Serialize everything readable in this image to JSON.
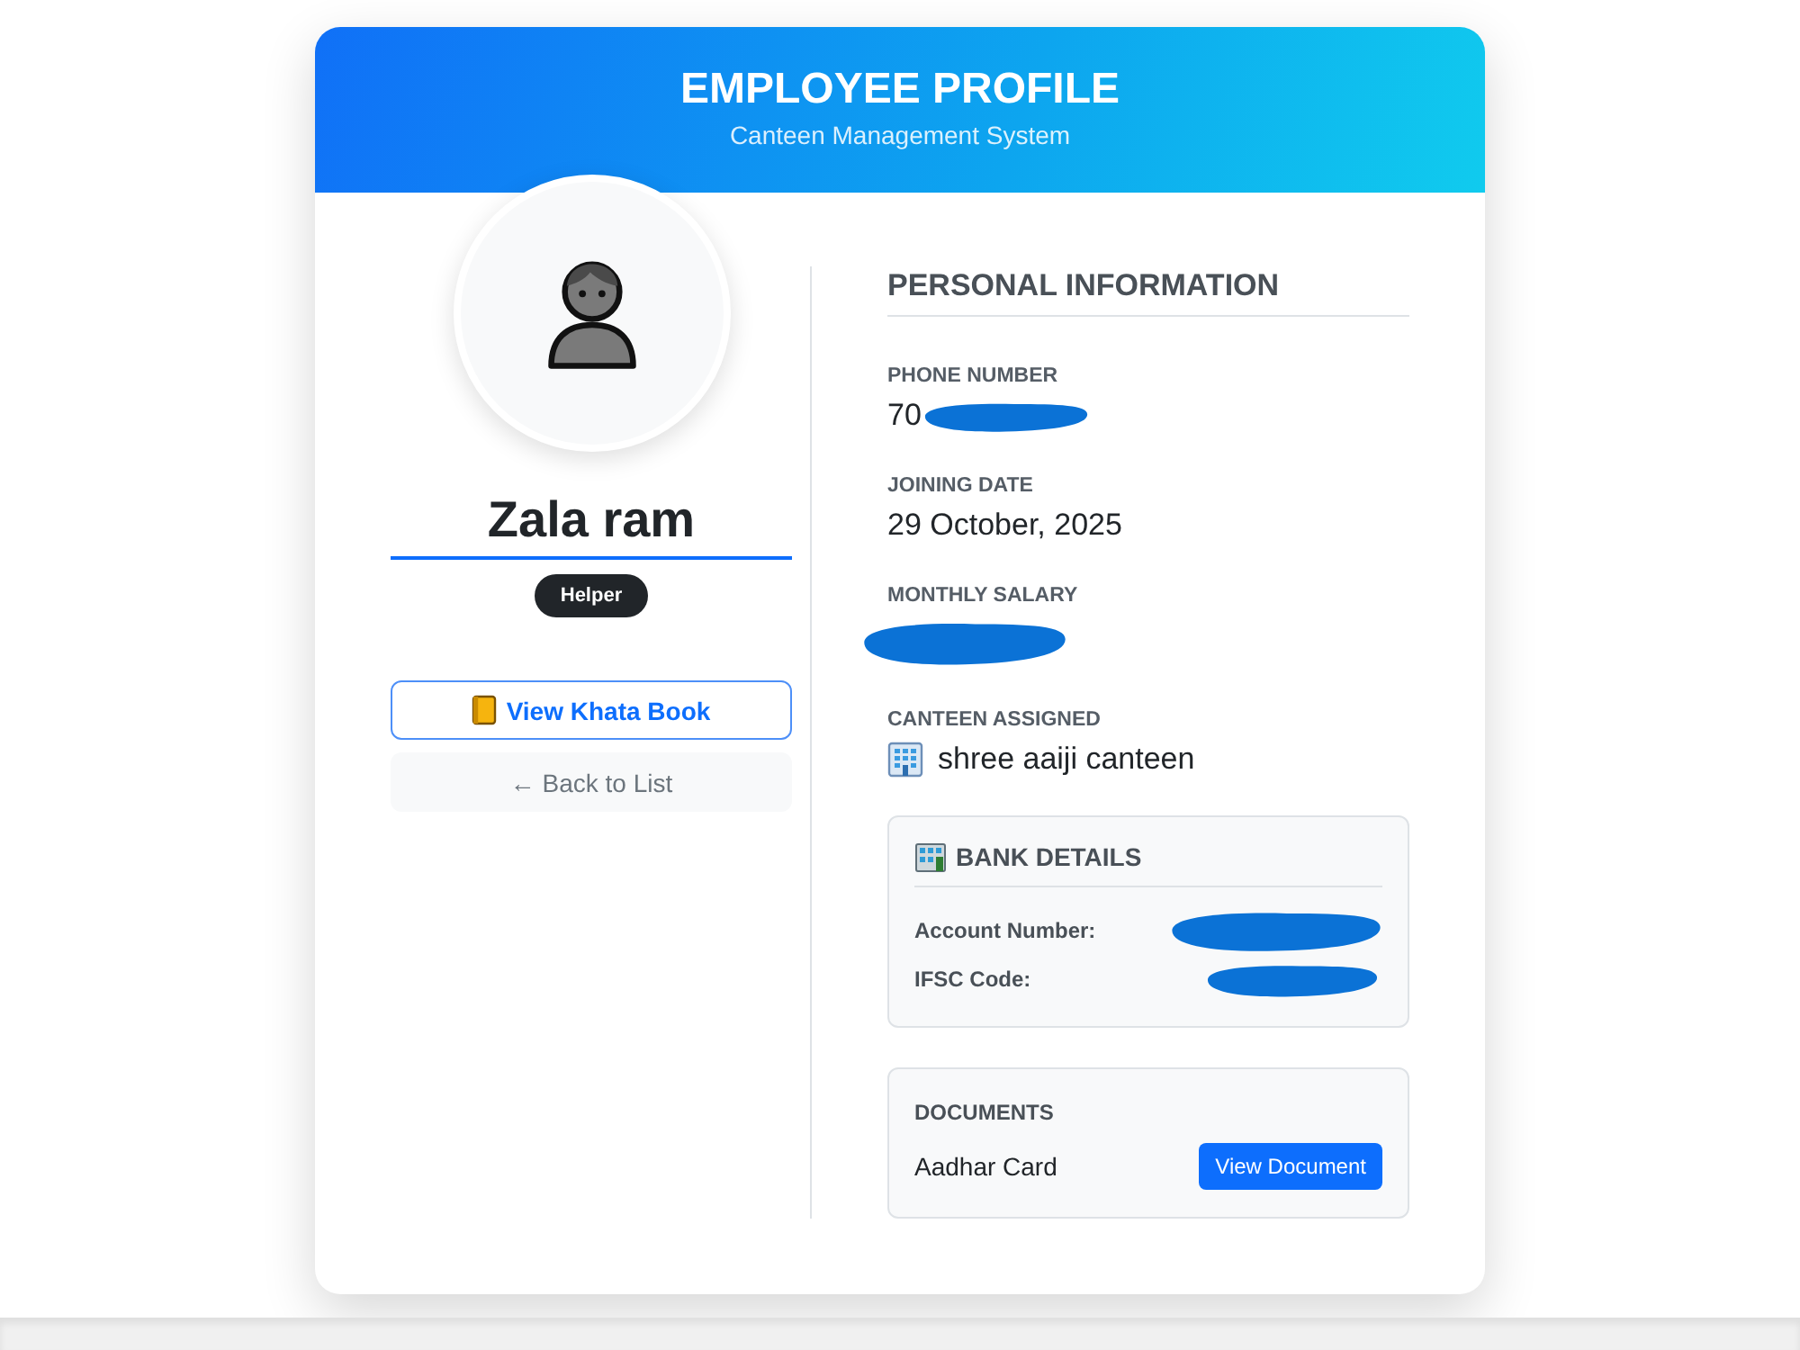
{
  "header": {
    "title": "EMPLOYEE PROFILE",
    "subtitle": "Canteen Management System"
  },
  "profile": {
    "name": "Zala ram",
    "role": "Helper"
  },
  "actions": [
    {
      "label": "View Khata Book",
      "kind": "primary"
    },
    {
      "label": "← Back to List",
      "kind": "secondary"
    }
  ],
  "personal_information": {
    "title": "PERSONAL INFORMATION",
    "fields": [
      {
        "label": "PHONE NUMBER",
        "value": "70",
        "kind": "text",
        "redacted": true
      },
      {
        "label": "JOINING DATE",
        "value": "29 October, 2025",
        "kind": "text",
        "redacted": false
      },
      {
        "label": "MONTHLY SALARY",
        "kind": "text",
        "redacted": true
      },
      {
        "label": "CANTEEN ASSIGNED",
        "value": "shree aaiji canteen",
        "kind": "place",
        "redacted": false
      }
    ]
  },
  "bank_details": {
    "title": "BANK DETAILS",
    "rows": [
      {
        "label": "Account Number:",
        "redacted": true
      },
      {
        "label": "IFSC Code:",
        "redacted": true
      }
    ]
  },
  "documents": {
    "title": "DOCUMENTS",
    "items": [
      {
        "name": "Aadhar Card",
        "action": "View Document"
      }
    ]
  }
}
